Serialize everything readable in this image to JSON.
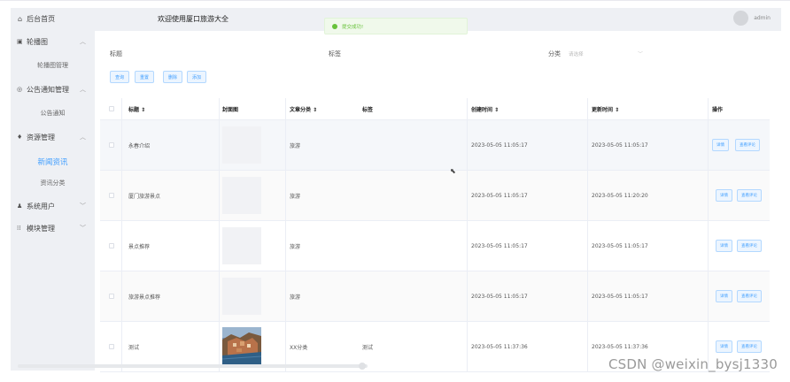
{
  "header": {
    "home_label": "后台首页",
    "welcome": "欢迎使用厦口旅游大全",
    "username": "admin"
  },
  "toast": {
    "text": "提交成功!"
  },
  "sidebar": {
    "items": [
      {
        "type": "group",
        "icon": "image-icon",
        "label": "轮播图",
        "chevron": "︿"
      },
      {
        "type": "sub",
        "label": "轮播图管理"
      },
      {
        "type": "group",
        "icon": "notice-icon",
        "label": "公告通知管理",
        "chevron": "︿"
      },
      {
        "type": "sub",
        "label": "公告通知"
      },
      {
        "type": "group",
        "icon": "resource-icon",
        "label": "资源管理",
        "chevron": "︿"
      },
      {
        "type": "sub",
        "label": "新闻资讯",
        "active": true
      },
      {
        "type": "sub",
        "label": "资讯分类"
      },
      {
        "type": "group",
        "icon": "user-icon",
        "label": "系统用户",
        "chevron": "﹀"
      },
      {
        "type": "group",
        "icon": "module-icon",
        "label": "模块管理",
        "chevron": "﹀"
      }
    ]
  },
  "filters": {
    "title_label": "标题",
    "tag_label": "标签",
    "category_label": "分类",
    "category_placeholder": "请选择"
  },
  "actions": {
    "query": "查询",
    "reset": "重置",
    "delete": "删除",
    "add": "添加"
  },
  "table": {
    "columns": {
      "title": "标题 ⇕",
      "cover": "封面图",
      "category": "文章分类 ⇕",
      "tags": "标签",
      "created": "创建时间 ⇕",
      "updated": "更新时间 ⇕",
      "ops": "操作"
    },
    "rows": [
      {
        "title": "永春介绍",
        "category": "旅游",
        "tags": "",
        "created": "2023-05-05 11:05:17",
        "updated": "2023-05-05 11:05:17",
        "has_photo": false,
        "op1": "详情",
        "op2": "查看评论"
      },
      {
        "title": "厦门旅游景点",
        "category": "旅游",
        "tags": "",
        "created": "2023-05-05 11:05:17",
        "updated": "2023-05-05 11:20:20",
        "has_photo": false,
        "op1": "详情",
        "op2": "查看评论"
      },
      {
        "title": "景点推荐",
        "category": "旅游",
        "tags": "",
        "created": "2023-05-05 11:05:17",
        "updated": "2023-05-05 11:05:17",
        "has_photo": false,
        "op1": "详情",
        "op2": "查看评论"
      },
      {
        "title": "旅游景点推荐",
        "category": "旅游",
        "tags": "",
        "created": "2023-05-05 11:05:17",
        "updated": "2023-05-05 11:05:17",
        "has_photo": false,
        "op1": "详情",
        "op2": "查看评论"
      },
      {
        "title": "测试",
        "category": "XX分类",
        "tags": "测试",
        "created": "2023-05-05 11:37:36",
        "updated": "2023-05-05 11:37:36",
        "has_photo": true,
        "op1": "详情",
        "op2": "查看评论"
      }
    ]
  },
  "watermark": "CSDN @weixin_bysj1330"
}
